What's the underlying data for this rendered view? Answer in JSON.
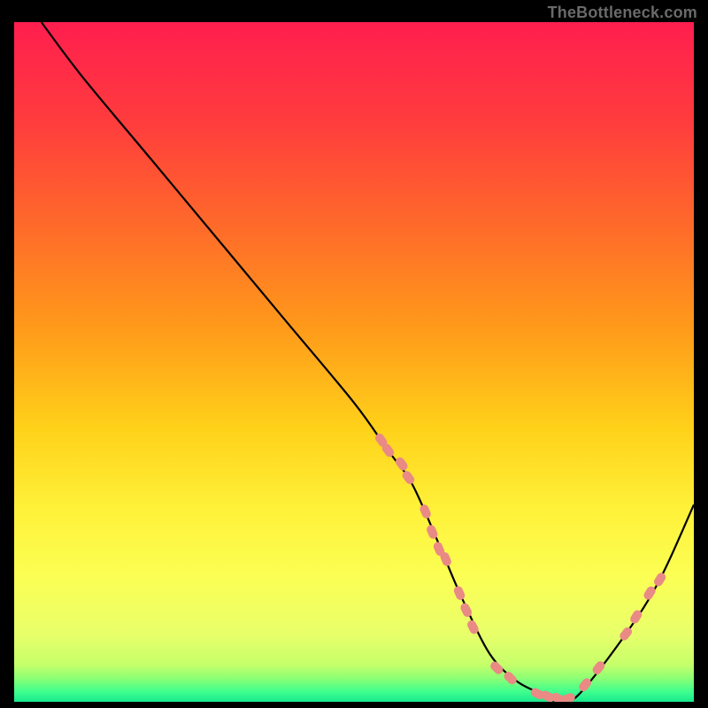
{
  "watermark": "TheBottleneck.com",
  "chart_data": {
    "type": "line",
    "title": "",
    "xlabel": "",
    "ylabel": "",
    "xlim": [
      0,
      100
    ],
    "ylim": [
      0,
      100
    ],
    "grid": false,
    "legend": false,
    "series": [
      {
        "name": "curve",
        "x": [
          4,
          10,
          20,
          30,
          40,
          50,
          55,
          58,
          60,
          63,
          66,
          70,
          74,
          78,
          80,
          83,
          90,
          95,
          100
        ],
        "y": [
          100,
          92,
          80,
          68,
          56,
          44,
          37,
          33,
          29,
          22,
          15,
          7,
          3,
          1,
          0,
          1,
          10,
          18,
          29
        ]
      }
    ],
    "markers": {
      "name": "salmon-dashes",
      "color": "#e98a85",
      "points_xy": [
        [
          54,
          38.5
        ],
        [
          55,
          37
        ],
        [
          57,
          35
        ],
        [
          58,
          33
        ],
        [
          60.5,
          28
        ],
        [
          61.5,
          25
        ],
        [
          62.5,
          22.5
        ],
        [
          63.5,
          21
        ],
        [
          65.5,
          16
        ],
        [
          66.5,
          13.5
        ],
        [
          67.5,
          11
        ],
        [
          71,
          5
        ],
        [
          73,
          3.5
        ],
        [
          77,
          1.2
        ],
        [
          78.5,
          0.8
        ],
        [
          80,
          0.5
        ],
        [
          81.5,
          0.5
        ],
        [
          84,
          2.5
        ],
        [
          86,
          5
        ],
        [
          90,
          10
        ],
        [
          91.5,
          12.5
        ],
        [
          93.5,
          16
        ],
        [
          95,
          18
        ]
      ]
    },
    "background_gradient": {
      "type": "vertical",
      "stops": [
        {
          "offset": 0.0,
          "color": "#ff1e4f"
        },
        {
          "offset": 0.15,
          "color": "#ff3d3d"
        },
        {
          "offset": 0.3,
          "color": "#ff6a2a"
        },
        {
          "offset": 0.45,
          "color": "#ff9a1a"
        },
        {
          "offset": 0.6,
          "color": "#ffd21a"
        },
        {
          "offset": 0.72,
          "color": "#fff23a"
        },
        {
          "offset": 0.82,
          "color": "#fbff55"
        },
        {
          "offset": 0.9,
          "color": "#e8ff6a"
        },
        {
          "offset": 0.945,
          "color": "#c6ff6a"
        },
        {
          "offset": 0.965,
          "color": "#8dff74"
        },
        {
          "offset": 0.985,
          "color": "#3fff8e"
        },
        {
          "offset": 1.0,
          "color": "#18e98e"
        }
      ]
    }
  }
}
